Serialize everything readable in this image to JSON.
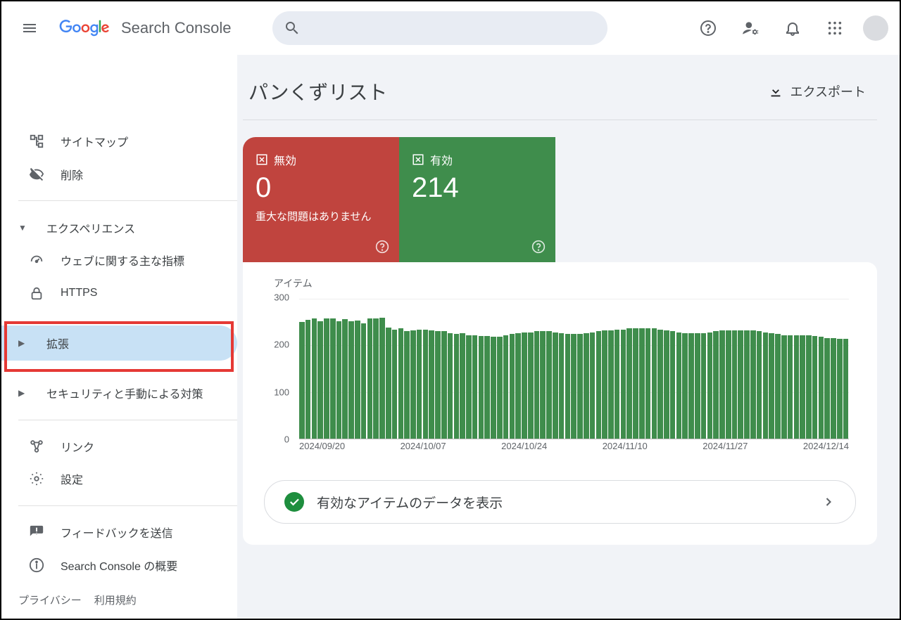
{
  "app": {
    "logo_text": "Search Console"
  },
  "header": {
    "search_placeholder": "",
    "icons": {
      "help": "help",
      "settings": "settings-user",
      "notification": "bell",
      "apps": "apps-grid",
      "avatar": "avatar"
    }
  },
  "sidebar": {
    "items": [
      {
        "label": "サイトマップ",
        "icon": "sitemap"
      },
      {
        "label": "削除",
        "icon": "visibility-off"
      }
    ],
    "section_experience": "エクスペリエンス",
    "experience_items": [
      {
        "label": "ウェブに関する主な指標",
        "icon": "gauge"
      },
      {
        "label": "HTTPS",
        "icon": "lock"
      }
    ],
    "section_enhance": "拡張",
    "section_security": "セキュリティと手動による対策",
    "link_item": "リンク",
    "settings_item": "設定",
    "feedback": "フィードバックを送信",
    "about": "Search Console の概要",
    "privacy": "プライバシー",
    "terms": "利用規約"
  },
  "page": {
    "title": "パンくずリスト",
    "export": "エクスポート"
  },
  "status": {
    "invalid_label": "無効",
    "invalid_count": "0",
    "invalid_sub": "重大な問題はありません",
    "valid_label": "有効",
    "valid_count": "214"
  },
  "chart_data": {
    "type": "bar",
    "title": "アイテム",
    "ylabel": "",
    "xlabel": "",
    "ylim": [
      0,
      300
    ],
    "y_ticks": [
      "0",
      "100",
      "200",
      "300"
    ],
    "x_ticks": [
      "2024/09/20",
      "2024/10/07",
      "2024/10/24",
      "2024/11/10",
      "2024/11/27",
      "2024/12/14"
    ],
    "series": [
      {
        "name": "有効",
        "values": [
          250,
          255,
          258,
          252,
          258,
          258,
          252,
          256,
          252,
          254,
          248,
          258,
          258,
          260,
          238,
          234,
          236,
          230,
          232,
          234,
          233,
          232,
          230,
          230,
          226,
          224,
          226,
          222,
          222,
          220,
          220,
          218,
          218,
          222,
          224,
          226,
          228,
          228,
          230,
          230,
          230,
          228,
          226,
          224,
          224,
          224,
          226,
          228,
          230,
          232,
          232,
          234,
          234,
          236,
          236,
          236,
          236,
          236,
          234,
          232,
          230,
          228,
          226,
          226,
          226,
          226,
          228,
          230,
          232,
          232,
          232,
          232,
          232,
          232,
          230,
          228,
          226,
          224,
          222,
          222,
          222,
          222,
          222,
          220,
          218,
          216,
          216,
          214,
          214
        ]
      }
    ]
  },
  "view_button": "有効なアイテムのデータを表示"
}
